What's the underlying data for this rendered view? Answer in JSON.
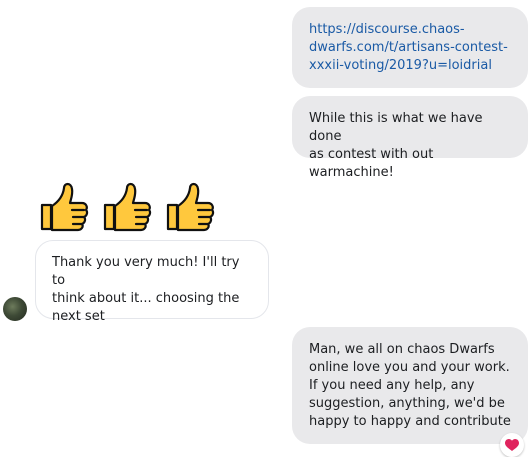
{
  "messages": [
    {
      "id": "m1",
      "direction": "outgoing",
      "link": "https://discourse.chaos-dwarfs.com/t/artisans-contest-xxxii-voting/2019?u=loidrial",
      "lines": [
        "https://discourse.chaos-",
        "dwarfs.com/t/artisans-contest-",
        "xxxii-voting/2019?u=loidrial"
      ]
    },
    {
      "id": "m2",
      "direction": "outgoing",
      "text": "While this is what we have done as contest with out warmachine!",
      "lines": [
        "While this is what we have done",
        "as contest with out warmachine!"
      ]
    },
    {
      "id": "m3",
      "direction": "incoming",
      "type": "emoji",
      "emoji": "👍👍👍",
      "icons": [
        "thumbs-up-icon",
        "thumbs-up-icon",
        "thumbs-up-icon"
      ]
    },
    {
      "id": "m4",
      "direction": "incoming",
      "text": "Thank you very much! I'll try to think about it... choosing the next set",
      "lines": [
        "Thank you very much! I'll try to",
        "think about it... choosing the",
        "next set"
      ]
    },
    {
      "id": "m5",
      "direction": "outgoing",
      "text": "Man, we all on chaos Dwarfs online love you and your work. If you need any help, any suggestion, anything, we'd be happy to happy and contribute",
      "lines": [
        "Man, we all on chaos Dwarfs",
        "online love you and your work.",
        "If you need any help, any",
        "suggestion, anything, we'd be",
        "happy to happy and contribute"
      ]
    }
  ],
  "reaction": {
    "icon": "heart-icon",
    "color": "#e0245e"
  },
  "colors": {
    "outgoing_bubble": "#e9e9eb",
    "incoming_border": "#e4e6eb",
    "link": "#1a5aa5"
  }
}
